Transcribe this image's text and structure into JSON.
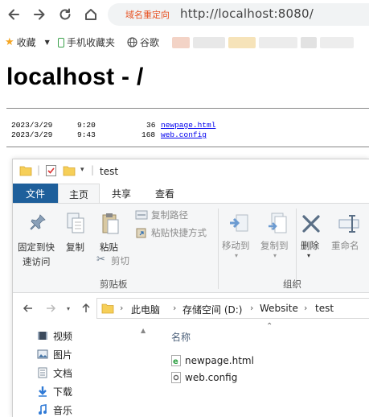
{
  "browser": {
    "redirect_tag": "域名重定向",
    "url": "http://localhost:8080/",
    "bookmarks": [
      {
        "label": "收藏",
        "icon": "star-icon"
      },
      {
        "label": "手机收藏夹",
        "icon": "phone-icon"
      },
      {
        "label": "谷歌",
        "icon": "globe-icon"
      }
    ]
  },
  "page": {
    "title": "localhost - /",
    "listing": [
      {
        "date": "2023/3/29",
        "time": "9:20",
        "size": "36",
        "name": "newpage.html"
      },
      {
        "date": "2023/3/29",
        "time": "9:43",
        "size": "168",
        "name": "web.config"
      }
    ]
  },
  "explorer": {
    "title": "test",
    "tabs": [
      "文件",
      "主页",
      "共享",
      "查看"
    ],
    "ribbon": {
      "pin_label_1": "固定到快",
      "pin_label_2": "速访问",
      "copy": "复制",
      "paste": "粘贴",
      "copy_path": "复制路径",
      "paste_shortcut": "粘贴快捷方式",
      "cut": "剪切",
      "clipboard_group": "剪贴板",
      "move_to": "移动到",
      "copy_to": "复制到",
      "delete": "删除",
      "rename": "重命名",
      "organize_group": "组织"
    },
    "breadcrumb": [
      "此电脑",
      "存储空间 (D:)",
      "Website",
      "test"
    ],
    "nav_items": [
      {
        "label": "视频",
        "icon": "video-icon"
      },
      {
        "label": "图片",
        "icon": "pictures-icon"
      },
      {
        "label": "文档",
        "icon": "documents-icon"
      },
      {
        "label": "下载",
        "icon": "download-icon"
      },
      {
        "label": "音乐",
        "icon": "music-icon"
      }
    ],
    "column_header": "名称",
    "files": [
      {
        "name": "newpage.html",
        "icon": "html-file-icon"
      },
      {
        "name": "web.config",
        "icon": "config-file-icon"
      }
    ]
  },
  "colors": {
    "file_tab": "#1e5f9b",
    "redirect": "#e8501f",
    "link": "#0000ee"
  }
}
